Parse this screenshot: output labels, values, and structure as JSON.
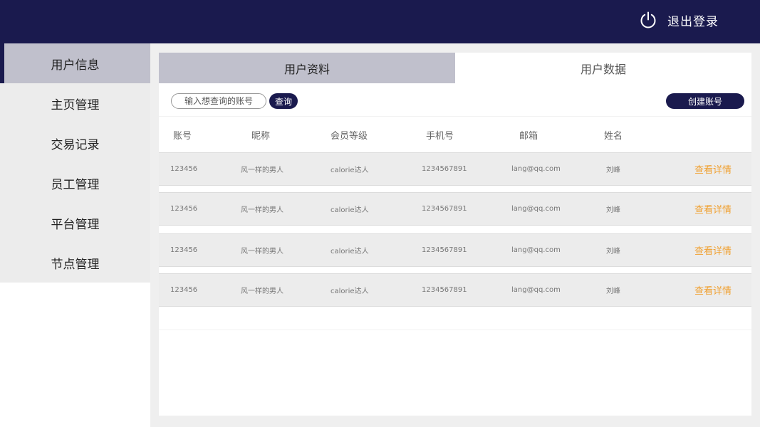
{
  "header": {
    "logout_label": "退出登录"
  },
  "sidebar": {
    "items": [
      {
        "label": "用户信息"
      },
      {
        "label": "主页管理"
      },
      {
        "label": "交易记录"
      },
      {
        "label": "员工管理"
      },
      {
        "label": "平台管理"
      },
      {
        "label": "节点管理"
      }
    ]
  },
  "tabs": [
    {
      "label": "用户资料"
    },
    {
      "label": "用户数据"
    }
  ],
  "toolbar": {
    "search_placeholder": "输入想查询的账号",
    "search_label": "查询",
    "create_label": "创建账号"
  },
  "table": {
    "columns": [
      "账号",
      "昵称",
      "会员等级",
      "手机号",
      "邮箱",
      "姓名"
    ],
    "detail_label": "查看详情",
    "rows": [
      {
        "account": "123456",
        "nickname": "风一样的男人",
        "level": "calorie达人",
        "phone": "1234567891",
        "email": "lang@qq.com",
        "name": "刘峰"
      },
      {
        "account": "123456",
        "nickname": "风一样的男人",
        "level": "calorie达人",
        "phone": "1234567891",
        "email": "lang@qq.com",
        "name": "刘峰"
      },
      {
        "account": "123456",
        "nickname": "风一样的男人",
        "level": "calorie达人",
        "phone": "1234567891",
        "email": "lang@qq.com",
        "name": "刘峰"
      },
      {
        "account": "123456",
        "nickname": "风一样的男人",
        "level": "calorie达人",
        "phone": "1234567891",
        "email": "lang@qq.com",
        "name": "刘峰"
      }
    ]
  },
  "colors": {
    "primary": "#1a1a4e",
    "active_bg": "#c0c0cc",
    "accent": "#f0a030"
  }
}
